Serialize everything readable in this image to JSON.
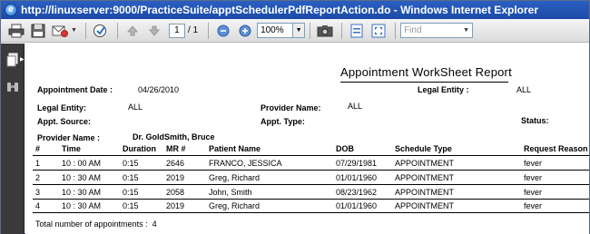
{
  "window": {
    "title": "http://linuxserver:9000/PracticeSuite/apptSchedulerPdfReportAction.do - Windows Internet Explorer"
  },
  "toolbar": {
    "page_current": "1",
    "page_total": "/ 1",
    "zoom": "100%",
    "find_placeholder": "Find"
  },
  "report": {
    "title": "Appointment WorkSheet Report",
    "appointment_date_label": "Appointment Date :",
    "appointment_date_value": "04/26/2010",
    "legal_entity_top_label": "Legal Entity :",
    "legal_entity_top_value": "ALL",
    "legal_entity_label": "Legal Entity:",
    "legal_entity_value": "ALL",
    "provider_name_label": "Provider Name:",
    "provider_name_value": "ALL",
    "appt_source_label": "Appt. Source:",
    "appt_type_label": "Appt. Type:",
    "status_label": "Status:",
    "provider_name2_label": "Provider Name :",
    "provider_name2_value": "Dr. GoldSmith, Bruce",
    "columns": [
      "#",
      "Time",
      "Duration",
      "MR #",
      "Patient  Name",
      "DOB",
      "Schedule Type",
      "Request Reason"
    ],
    "rows": [
      [
        "1",
        "10 : 00 AM",
        "0:15",
        "2646",
        "FRANCO, JESSICA",
        "07/29/1981",
        "APPOINTMENT",
        "fever"
      ],
      [
        "2",
        "10 : 30 AM",
        "0:15",
        "2019",
        "Greg, Richard",
        "01/01/1960",
        "APPOINTMENT",
        "fever"
      ],
      [
        "3",
        "10 : 30 AM",
        "0:15",
        "2058",
        "John, Smith",
        "08/23/1962",
        "APPOINTMENT",
        "fever"
      ],
      [
        "4",
        "10 : 30 AM",
        "0:15",
        "2019",
        "Greg, Richard",
        "01/01/1960",
        "APPOINTMENT",
        "fever"
      ]
    ],
    "total_label": "Total number of appointments :",
    "total_value": "4"
  }
}
